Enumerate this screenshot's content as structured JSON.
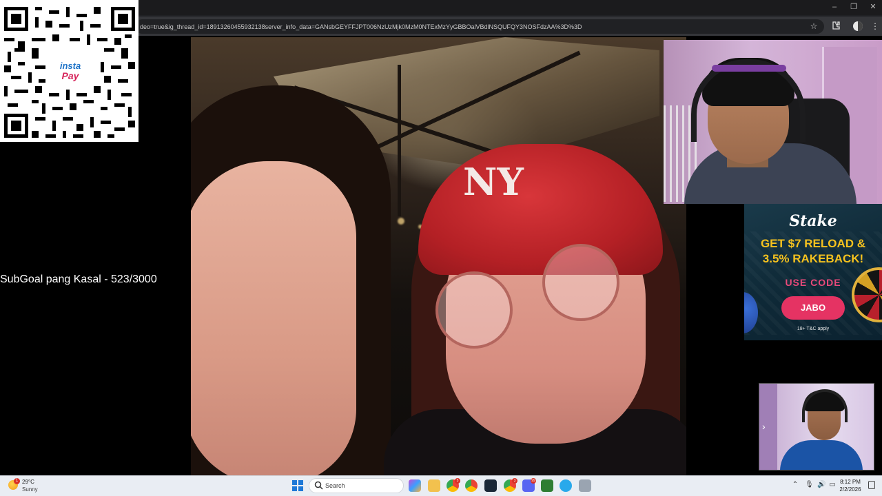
{
  "browser": {
    "url": "deo=true&ig_thread_id=18913260455932138server_info_data=GANsbGEYFFJPT006NzUzMjk0MzM0NTExMzYyGBBOalVBdlNSQUFQY3NOSFdzAA%3D%3D",
    "window_controls": [
      "–",
      "❐",
      "✕"
    ]
  },
  "overlay": {
    "qr_brand_top": "insta",
    "qr_brand_bottom": "Pay",
    "subgoal": "SubGoal pang Kasal - 523/3000"
  },
  "main_video": {
    "beanie_logo": "NY"
  },
  "ad": {
    "brand": "Stake",
    "headline_1": "GET $7 RELOAD &",
    "headline_2": "3.5% RAKEBACK!",
    "use_code": "USE CODE",
    "code": "JABO",
    "terms": "18+  T&C apply"
  },
  "taskbar": {
    "weather_badge": "1",
    "weather_temp": "29°C",
    "weather_desc": "Sunny",
    "search_placeholder": "Search",
    "badges": {
      "app_a": "5",
      "app_b": "3",
      "app_c": "99"
    },
    "clock_time": "8:12 PM",
    "clock_date": "2/2/2026"
  },
  "colors": {
    "accent_pink": "#e53363",
    "ad_yellow": "#f6c21e",
    "windows_blue": "#1e78d7"
  }
}
